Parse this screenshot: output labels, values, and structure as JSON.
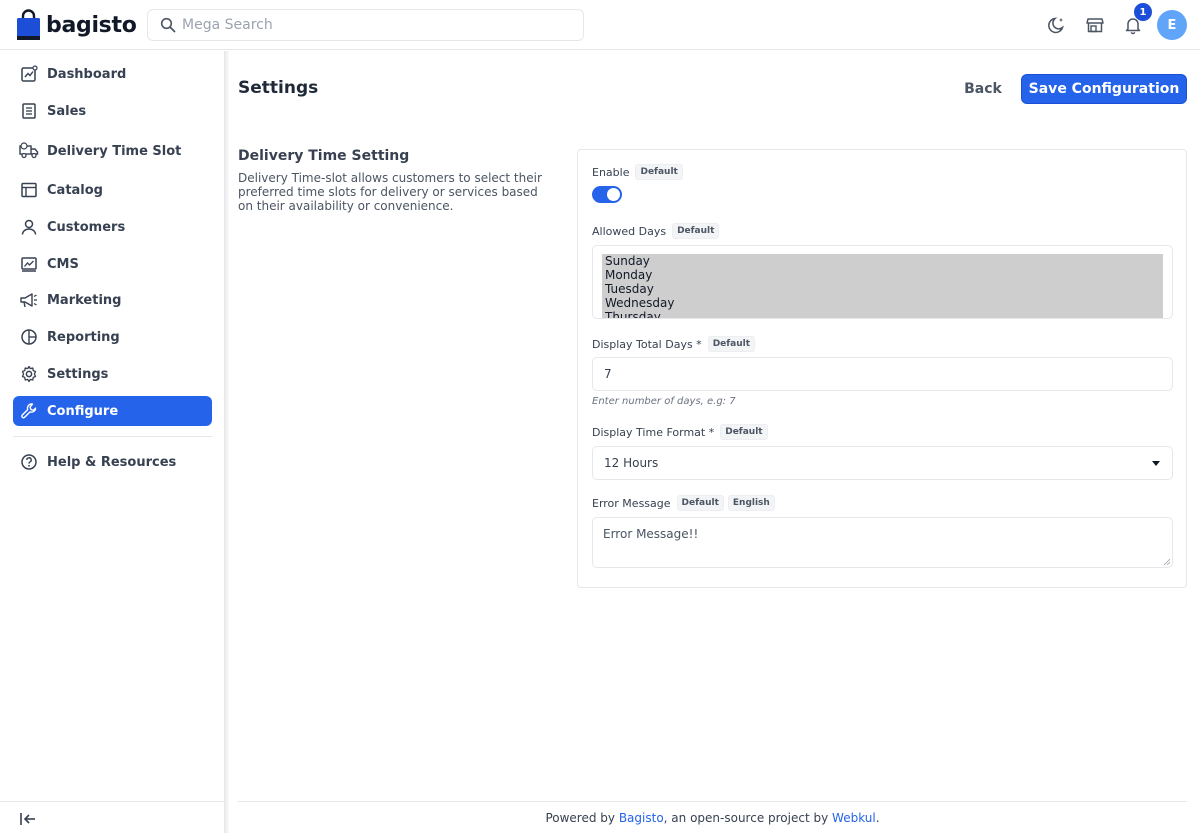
{
  "header": {
    "brand": "bagisto",
    "search_placeholder": "Mega Search",
    "notification_count": "1",
    "avatar_initial": "E"
  },
  "sidebar": {
    "items": [
      {
        "label": "Dashboard",
        "icon": "dashboard-icon"
      },
      {
        "label": "Sales",
        "icon": "sales-icon"
      },
      {
        "label": "Delivery Time Slot",
        "icon": "truck-icon"
      },
      {
        "label": "Catalog",
        "icon": "catalog-icon"
      },
      {
        "label": "Customers",
        "icon": "user-icon"
      },
      {
        "label": "CMS",
        "icon": "cms-icon"
      },
      {
        "label": "Marketing",
        "icon": "megaphone-icon"
      },
      {
        "label": "Reporting",
        "icon": "pie-chart-icon"
      },
      {
        "label": "Settings",
        "icon": "gear-icon"
      },
      {
        "label": "Configure",
        "icon": "wrench-icon",
        "active": true
      }
    ],
    "help_label": "Help & Resources"
  },
  "page": {
    "title": "Settings",
    "back_label": "Back",
    "save_label": "Save Configuration"
  },
  "section": {
    "title": "Delivery Time Setting",
    "description": "Delivery Time-slot allows customers to select their preferred time slots for delivery or services based on their availability or convenience."
  },
  "form": {
    "enable": {
      "label": "Enable",
      "tag": "Default",
      "value": true
    },
    "allowed_days": {
      "label": "Allowed Days",
      "tag": "Default",
      "options": [
        "Sunday",
        "Monday",
        "Tuesday",
        "Wednesday",
        "Thursday"
      ]
    },
    "total_days": {
      "label": "Display Total Days *",
      "tag": "Default",
      "value": "7",
      "hint": "Enter number of days, e.g: 7"
    },
    "time_format": {
      "label": "Display Time Format *",
      "tag": "Default",
      "value": "12 Hours"
    },
    "error_message": {
      "label": "Error Message",
      "tag": "Default",
      "locale_tag": "English",
      "value": "Error Message!!"
    }
  },
  "footer": {
    "prefix": "Powered by ",
    "bagisto_link": "Bagisto",
    "middle": ", an open-source project by ",
    "webkul_link": "Webkul",
    "suffix": "."
  },
  "colors": {
    "accent": "#2563eb",
    "badge": "#1d4ed8",
    "avatar": "#60a5fa"
  }
}
